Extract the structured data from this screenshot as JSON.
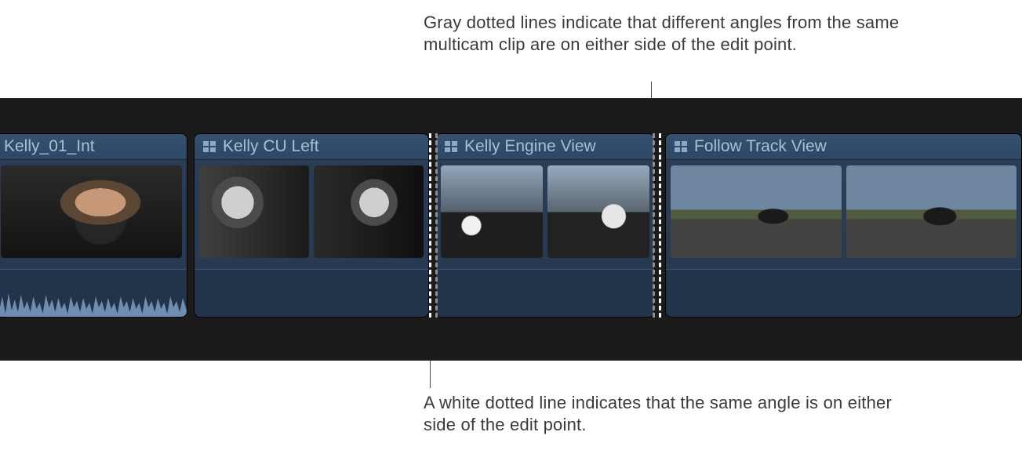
{
  "callouts": {
    "top": "Gray dotted lines indicate that different angles from the same multicam clip are on either side of the edit point.",
    "bottom": "A white dotted line indicates that the same angle is on either side of the edit point."
  },
  "clips": [
    {
      "label": "Kelly_01_Int",
      "multicam": false
    },
    {
      "label": "Kelly CU Left",
      "multicam": true
    },
    {
      "label": "Kelly Engine View",
      "multicam": true
    },
    {
      "label": "Follow Track View",
      "multicam": true
    }
  ],
  "edit_points": {
    "white_dotted": {
      "meaning": "same angle on either side"
    },
    "gray_dotted": {
      "meaning": "different angles on either side"
    }
  }
}
